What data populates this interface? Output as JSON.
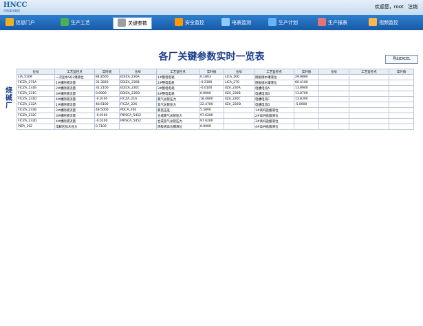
{
  "header": {
    "logo": "HNCC",
    "logo_sub": "河南煤化集团",
    "welcome": "欢迎您，root",
    "logout": "注销"
  },
  "nav": {
    "tabs": [
      {
        "label": "信息门户",
        "color": "#f0b020"
      },
      {
        "label": "生产工艺",
        "color": "#4caf50"
      },
      {
        "label": "关键参数",
        "color": "#9e9e9e"
      },
      {
        "label": "安全监控",
        "color": "#ff9800"
      },
      {
        "label": "电表监测",
        "color": "#90caf9"
      },
      {
        "label": "生产计划",
        "color": "#64b5f6"
      },
      {
        "label": "生产报表",
        "color": "#e57373"
      },
      {
        "label": "视频监控",
        "color": "#ffb74d"
      }
    ]
  },
  "title": "各厂关键参数实时一览表",
  "export_label": "导出EXCEL",
  "section1": {
    "label": "烧碱厂",
    "headers": [
      "位号",
      "工艺监控点",
      "实时值",
      "位号",
      "工艺监控点",
      "实时值",
      "位号",
      "工艺监控点",
      "实时值",
      "位号",
      "工艺监控点",
      "实时值"
    ],
    "rows": [
      [
        "LIA_5109",
        "一次盐水SQ3储液位",
        "84.8500",
        "EDIZA_230A",
        "1#整电电耗",
        "0.1803",
        "LICA_260",
        "阴极储水罐液位",
        "29.9880"
      ],
      [
        "FICZA_231A",
        "1#槽阴液流量",
        "31.3820",
        "EDIZA_230B",
        "2#整电电耗",
        "-0.2300",
        "LICA_270",
        "阴极储水罐液位",
        "60.4100"
      ],
      [
        "FICZA_231B",
        "2#槽阴液流量",
        "31.2100",
        "EDIZA_230C",
        "3#整电电耗",
        "-0.0100",
        "IIZA_230A",
        "电槽电流A",
        "13.8900"
      ],
      [
        "FICZA_231C",
        "3#槽阴液流量",
        "0.0000",
        "EDIZA_230D",
        "4#整电电耗",
        "0.0000",
        "IIZA_230B",
        "电槽电流B",
        "13.8700"
      ],
      [
        "FICZA_231D",
        "4#槽阴液流量",
        "-0.0100",
        "FICZA_216",
        "氯气总管压力",
        "18.4800",
        "IIZA_230C",
        "电槽电流C",
        "13.8300"
      ],
      [
        "FICZA_232A",
        "1#槽阴液流量",
        "46.6100",
        "FICZA_226",
        "氢气总管压力",
        "22.4700",
        "IIZA_230D",
        "电槽电流D",
        "-5.0000"
      ],
      [
        "FICZA_232B",
        "2#槽阴液流量",
        "48.5000",
        "PDCA_200",
        "氯氢压差",
        "5.5800",
        "",
        "1#高纯盐酸液位",
        ""
      ],
      [
        "FICZA_232C",
        "3#槽阴液流量",
        "-0.0100",
        "PIRSCA_5452",
        "合成氯气总管压力",
        "97.6200",
        "",
        "2#高纯盐酸液位",
        ""
      ],
      [
        "FICZA_232D",
        "4#槽阴液流量",
        "-0.0100",
        "PIRSCA_5452",
        "合成氢气总管压力",
        "97.6200",
        "",
        "3#高纯盐酸液位",
        ""
      ],
      [
        "PIZA_102",
        "电解区盐水压力",
        "0.7100",
        "",
        "阴极液高位槽液位",
        "0.0000",
        "",
        "4#高纯盐酸液位",
        ""
      ]
    ]
  }
}
